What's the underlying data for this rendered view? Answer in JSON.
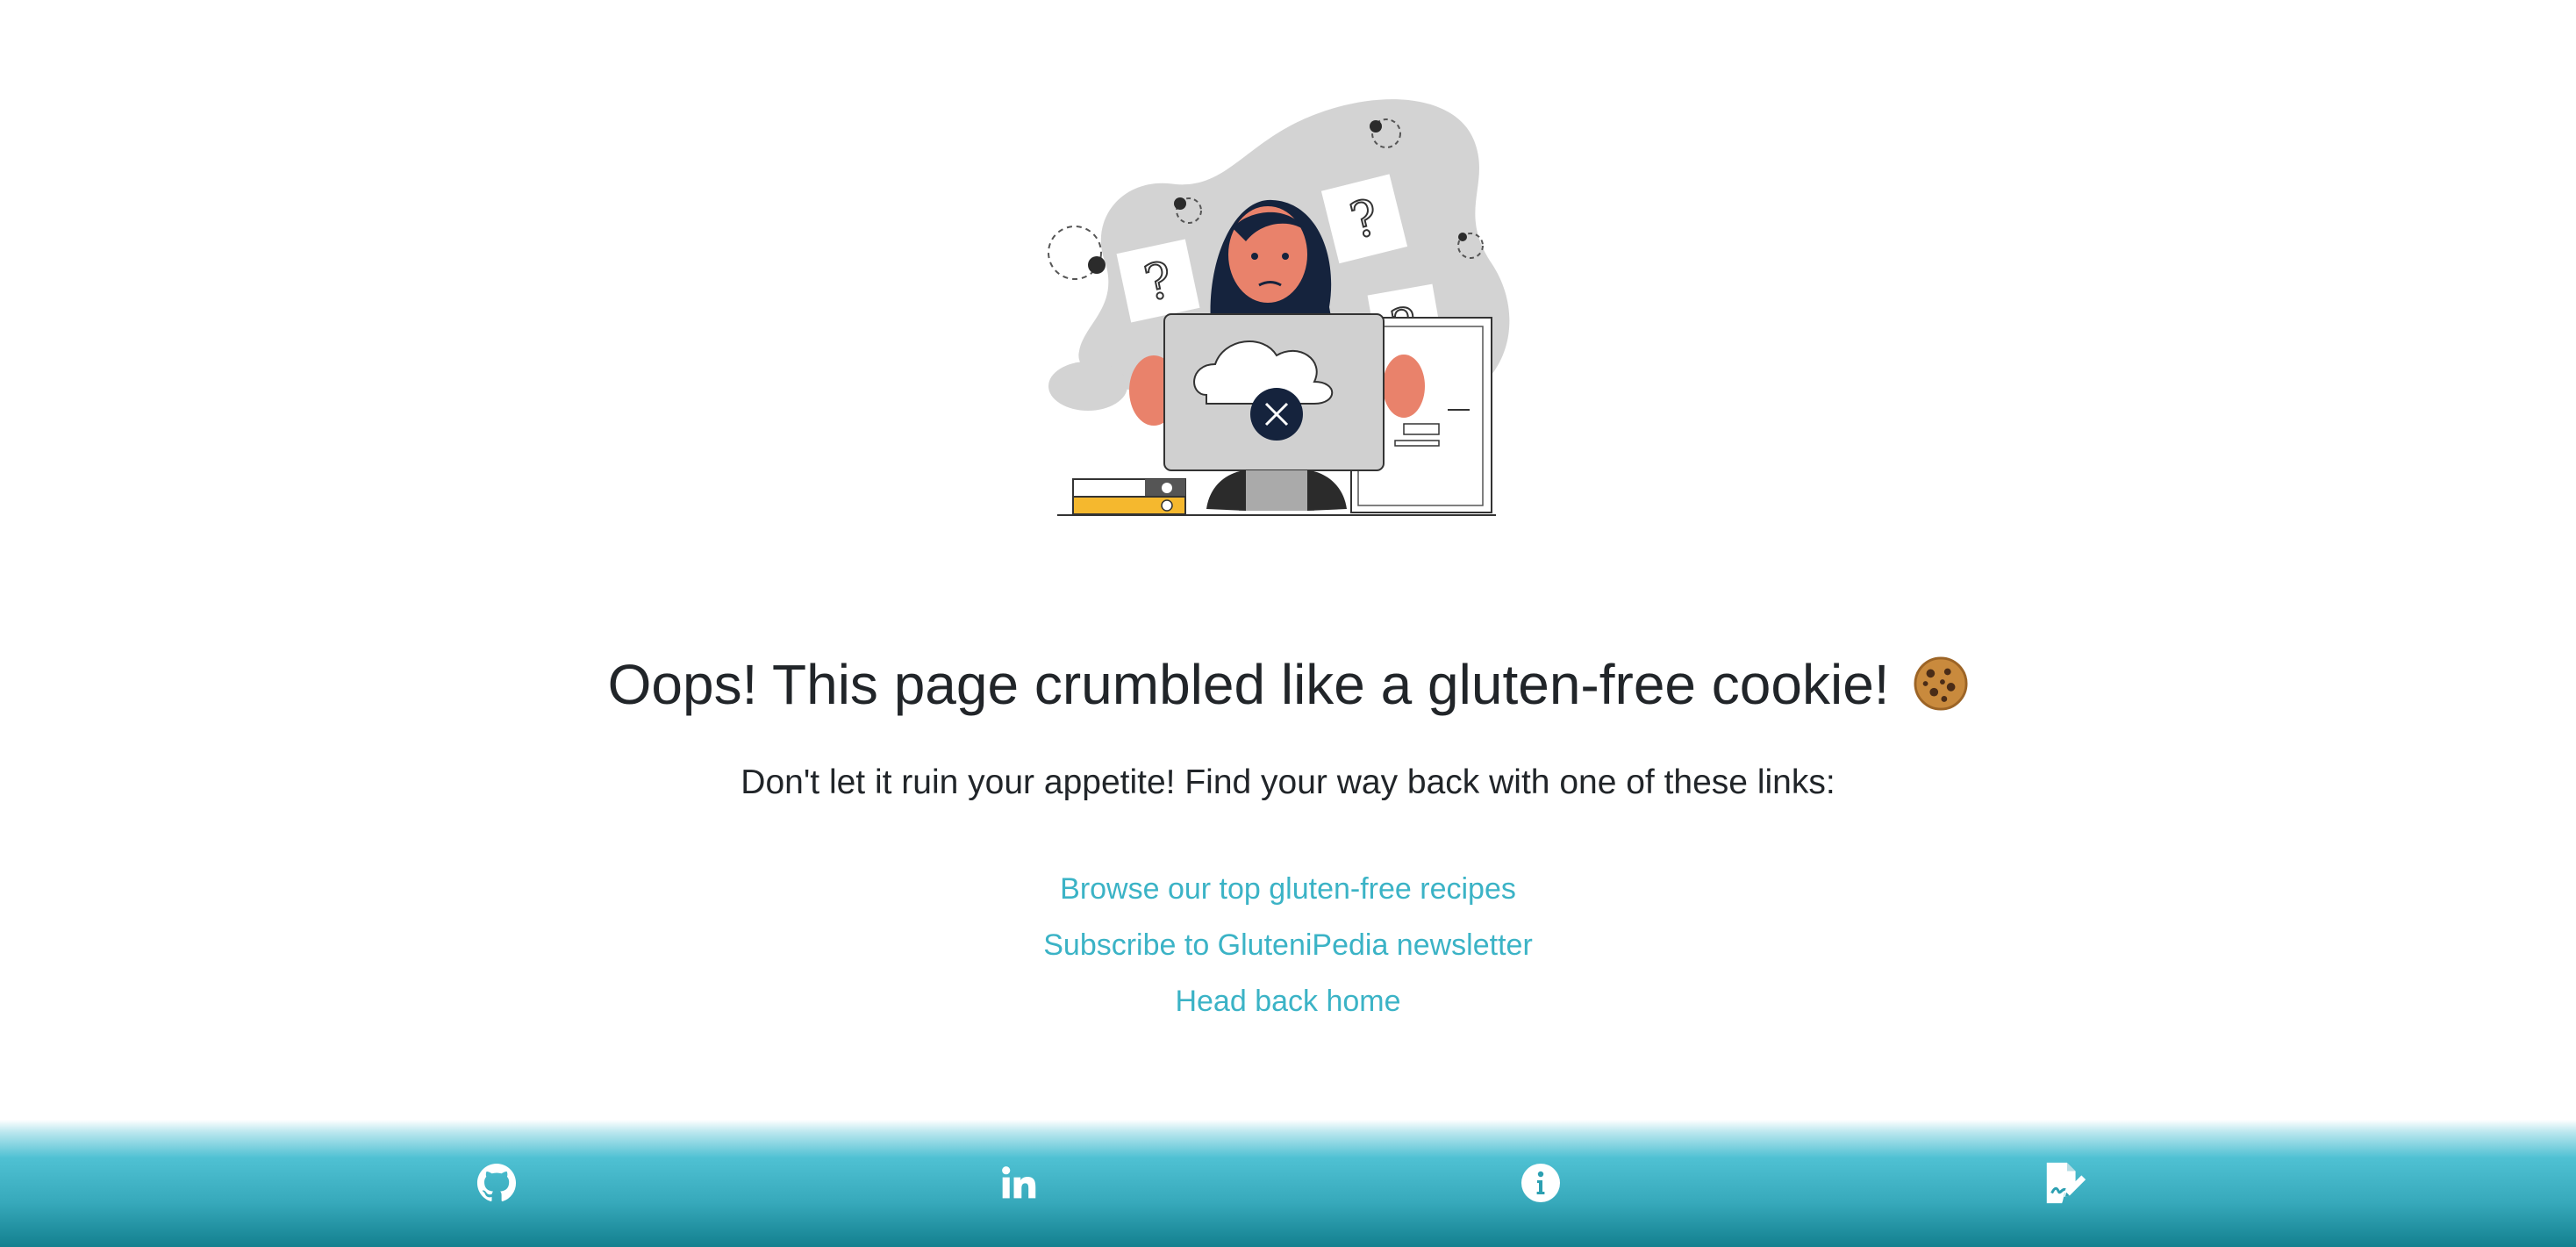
{
  "heading": {
    "text": "Oops! This page crumbled like a gluten-free cookie!",
    "emoji_icon": "cookie-icon"
  },
  "subheading": "Don't let it ruin your appetite! Find your way back with one of these links:",
  "links": [
    {
      "label": "Browse our top gluten-free recipes"
    },
    {
      "label": "Subscribe to GluteniPedia newsletter"
    },
    {
      "label": "Head back home"
    }
  ],
  "footer": {
    "icons": [
      "github-icon",
      "linkedin-icon",
      "info-icon",
      "signature-document-icon"
    ]
  },
  "colors": {
    "link": "#3bb3c6",
    "footer_top": "#4fc1d3",
    "footer_bottom": "#13808f",
    "illustration_blob": "#d3d3d3",
    "accent_yellow": "#f5b82e",
    "dark_navy": "#15233d"
  }
}
